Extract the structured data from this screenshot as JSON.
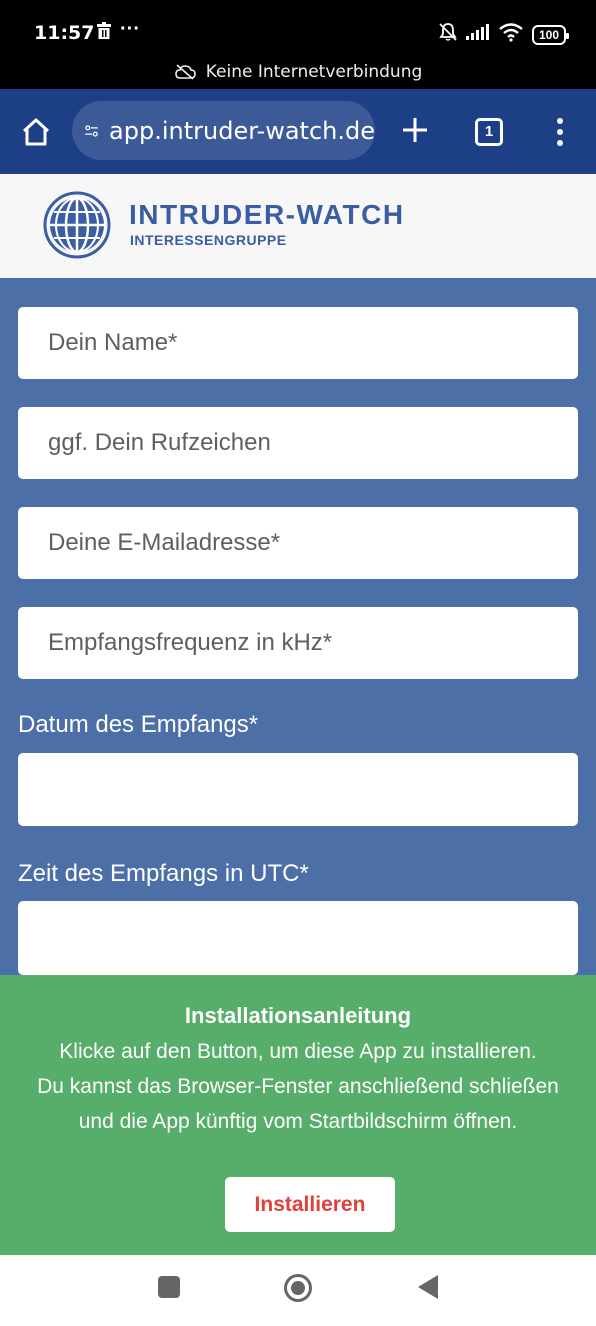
{
  "status": {
    "time": "11:57",
    "dots": "···",
    "battery": "100",
    "offline_message": "Keine Internetverbindung"
  },
  "browser": {
    "url": "app.intruder-watch.de",
    "tab_count": "1"
  },
  "header": {
    "title": "INTRUDER-WATCH",
    "subtitle": "INTERESSENGRUPPE"
  },
  "form": {
    "name_placeholder": "Dein Name*",
    "callsign_placeholder": "ggf. Dein Rufzeichen",
    "email_placeholder": "Deine E-Mailadresse*",
    "frequency_placeholder": "Empfangsfrequenz in kHz*",
    "date_label": "Datum des Empfangs*",
    "time_label": "Zeit des Empfangs in UTC*"
  },
  "install": {
    "title": "Installationsanleitung",
    "line1": "Klicke auf den Button, um diese App zu installieren.",
    "line2": "Du kannst das Browser-Fenster anschließend schließen",
    "line3": "und die App künftig vom Startbildschirm öffnen.",
    "button_label": "Installieren"
  },
  "colors": {
    "browser_bar": "#1c3f86",
    "form_background": "#4d6fa7",
    "install_panel": "#57ae6a",
    "install_button_text": "#e0423a",
    "logo": "#3a5da3"
  }
}
